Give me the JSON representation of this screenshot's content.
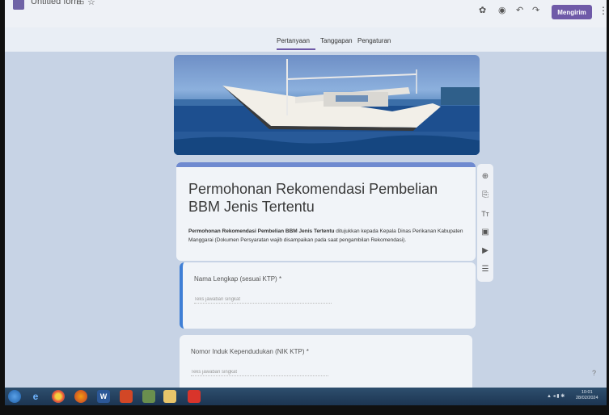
{
  "app": {
    "form_title": "Untitled form"
  },
  "toolbar": {
    "send_label": "Mengirim"
  },
  "tabs": [
    {
      "label": "Pertanyaan"
    },
    {
      "label": "Tanggapan"
    },
    {
      "label": "Pengaturan"
    }
  ],
  "form": {
    "heading": "Permohonan Rekomendasi Pembelian BBM Jenis Tertentu",
    "description_bold": "Permohonan Rekomendasi Pembelian BBM Jenis Tertentu",
    "description_rest": " ditujukkan kepada Kepala Dinas Perikanan Kabupaten Manggarai (Dokumen Persyaratan wajib disampaikan pada saat pengambilan Rekomendasi)."
  },
  "questions": [
    {
      "label": "Nama Lengkap (sesuai KTP) *",
      "placeholder": "Teks jawaban singkat"
    },
    {
      "label": "Nomor Induk Kependudukan (NIK KTP) *",
      "placeholder": "Teks jawaban singkat"
    }
  ],
  "taskbar": {
    "word_label": "W",
    "clock_time": "10:01",
    "clock_date": "28/02/2024"
  },
  "icons": {
    "side_tools": [
      "add-question-icon",
      "import-questions-icon",
      "add-title-icon",
      "add-image-icon",
      "add-video-icon",
      "add-section-icon"
    ]
  },
  "colors": {
    "accent": "#6f5aa8",
    "question_active": "#3f7fd6",
    "header_top": "#6f8ad0"
  }
}
